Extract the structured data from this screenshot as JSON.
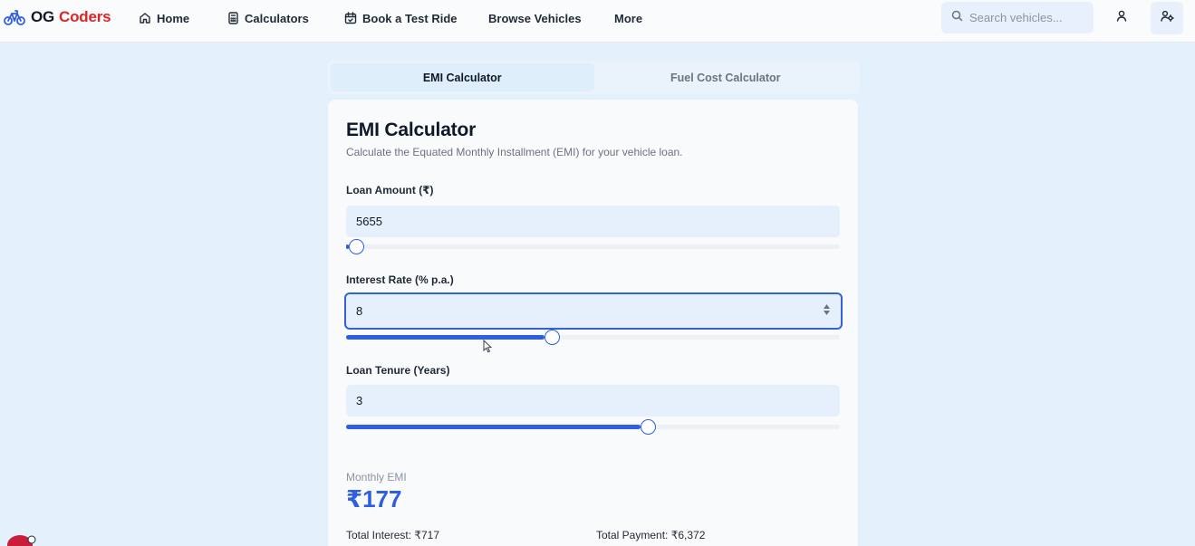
{
  "header": {
    "brand": {
      "part1": "OG",
      "part2": "Coders",
      "icon": "bicycle-icon"
    },
    "nav": [
      {
        "label": "Home",
        "icon": "home-icon"
      },
      {
        "label": "Calculators",
        "icon": "calculator-icon"
      },
      {
        "label": "Book a Test Ride",
        "icon": "calendar-check-icon"
      },
      {
        "label": "Browse Vehicles"
      },
      {
        "label": "More"
      }
    ],
    "search": {
      "placeholder": "Search vehicles...",
      "icon": "search-icon"
    },
    "user_icon": "user-icon",
    "admin_icon": "user-settings-icon"
  },
  "tabs": [
    {
      "label": "EMI Calculator",
      "active": true
    },
    {
      "label": "Fuel Cost Calculator",
      "active": false
    }
  ],
  "card": {
    "title": "EMI Calculator",
    "subtitle": "Calculate the Equated Monthly Installment (EMI) for your vehicle loan.",
    "fields": {
      "loan_amount": {
        "label": "Loan Amount (₹)",
        "value": "5655",
        "slider_fraction": 0.006
      },
      "interest_rate": {
        "label": "Interest Rate (% p.a.)",
        "value": "8",
        "slider_fraction": 0.402
      },
      "tenure": {
        "label": "Loan Tenure (Years)",
        "value": "3",
        "slider_fraction": 0.597
      }
    },
    "result": {
      "label": "Monthly EMI",
      "value": "₹177",
      "total_interest": "Total Interest: ₹717",
      "total_payment": "Total Payment: ₹6,372"
    }
  },
  "colors": {
    "accent": "#2f5ee0",
    "brand_red": "#dc2626",
    "background": "#e3f1fd"
  }
}
